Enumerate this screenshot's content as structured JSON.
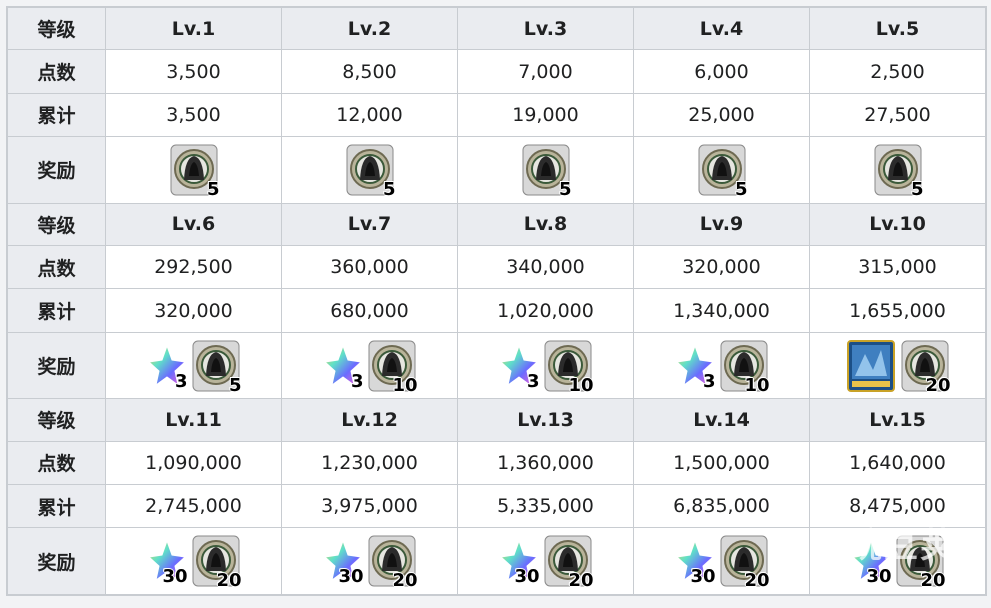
{
  "labels": {
    "level": "等级",
    "points": "点数",
    "total": "累计",
    "reward": "奖励"
  },
  "sections": [
    {
      "levels": [
        "Lv.1",
        "Lv.2",
        "Lv.3",
        "Lv.4",
        "Lv.5"
      ],
      "points": [
        "3,500",
        "8,500",
        "7,000",
        "6,000",
        "2,500"
      ],
      "totals": [
        "3,500",
        "12,000",
        "19,000",
        "25,000",
        "27,500"
      ],
      "rewards": [
        [
          {
            "icon": "hooded-figure-medal-icon",
            "count": "5"
          }
        ],
        [
          {
            "icon": "hooded-figure-medal-icon",
            "count": "5"
          }
        ],
        [
          {
            "icon": "hooded-figure-medal-icon",
            "count": "5"
          }
        ],
        [
          {
            "icon": "hooded-figure-medal-icon",
            "count": "5"
          }
        ],
        [
          {
            "icon": "hooded-figure-medal-icon",
            "count": "5"
          }
        ]
      ]
    },
    {
      "levels": [
        "Lv.6",
        "Lv.7",
        "Lv.8",
        "Lv.9",
        "Lv.10"
      ],
      "points": [
        "292,500",
        "360,000",
        "340,000",
        "320,000",
        "315,000"
      ],
      "totals": [
        "320,000",
        "680,000",
        "1,020,000",
        "1,340,000",
        "1,655,000"
      ],
      "rewards": [
        [
          {
            "icon": "rainbow-star-crystal-icon",
            "count": "3"
          },
          {
            "icon": "hooded-figure-medal-icon",
            "count": "5"
          }
        ],
        [
          {
            "icon": "rainbow-star-crystal-icon",
            "count": "3"
          },
          {
            "icon": "hooded-figure-medal-icon",
            "count": "10"
          }
        ],
        [
          {
            "icon": "rainbow-star-crystal-icon",
            "count": "3"
          },
          {
            "icon": "hooded-figure-medal-icon",
            "count": "10"
          }
        ],
        [
          {
            "icon": "rainbow-star-crystal-icon",
            "count": "3"
          },
          {
            "icon": "hooded-figure-medal-icon",
            "count": "10"
          }
        ],
        [
          {
            "icon": "craft-essence-card-icon",
            "count": ""
          },
          {
            "icon": "hooded-figure-medal-icon",
            "count": "20"
          }
        ]
      ]
    },
    {
      "levels": [
        "Lv.11",
        "Lv.12",
        "Lv.13",
        "Lv.14",
        "Lv.15"
      ],
      "points": [
        "1,090,000",
        "1,230,000",
        "1,360,000",
        "1,500,000",
        "1,640,000"
      ],
      "totals": [
        "2,745,000",
        "3,975,000",
        "5,335,000",
        "6,835,000",
        "8,475,000"
      ],
      "rewards": [
        [
          {
            "icon": "rainbow-star-crystal-icon",
            "count": "30"
          },
          {
            "icon": "hooded-figure-medal-icon",
            "count": "20"
          }
        ],
        [
          {
            "icon": "rainbow-star-crystal-icon",
            "count": "30"
          },
          {
            "icon": "hooded-figure-medal-icon",
            "count": "20"
          }
        ],
        [
          {
            "icon": "rainbow-star-crystal-icon",
            "count": "30"
          },
          {
            "icon": "hooded-figure-medal-icon",
            "count": "20"
          }
        ],
        [
          {
            "icon": "rainbow-star-crystal-icon",
            "count": "30"
          },
          {
            "icon": "hooded-figure-medal-icon",
            "count": "20"
          }
        ],
        [
          {
            "icon": "rainbow-star-crystal-icon",
            "count": "30"
          },
          {
            "icon": "hooded-figure-medal-icon",
            "count": "20"
          }
        ]
      ]
    }
  ],
  "watermark": "豌豆荚",
  "colors": {
    "header_bg": "#eaecf0",
    "border": "#c8ccd1",
    "text": "#202122"
  }
}
